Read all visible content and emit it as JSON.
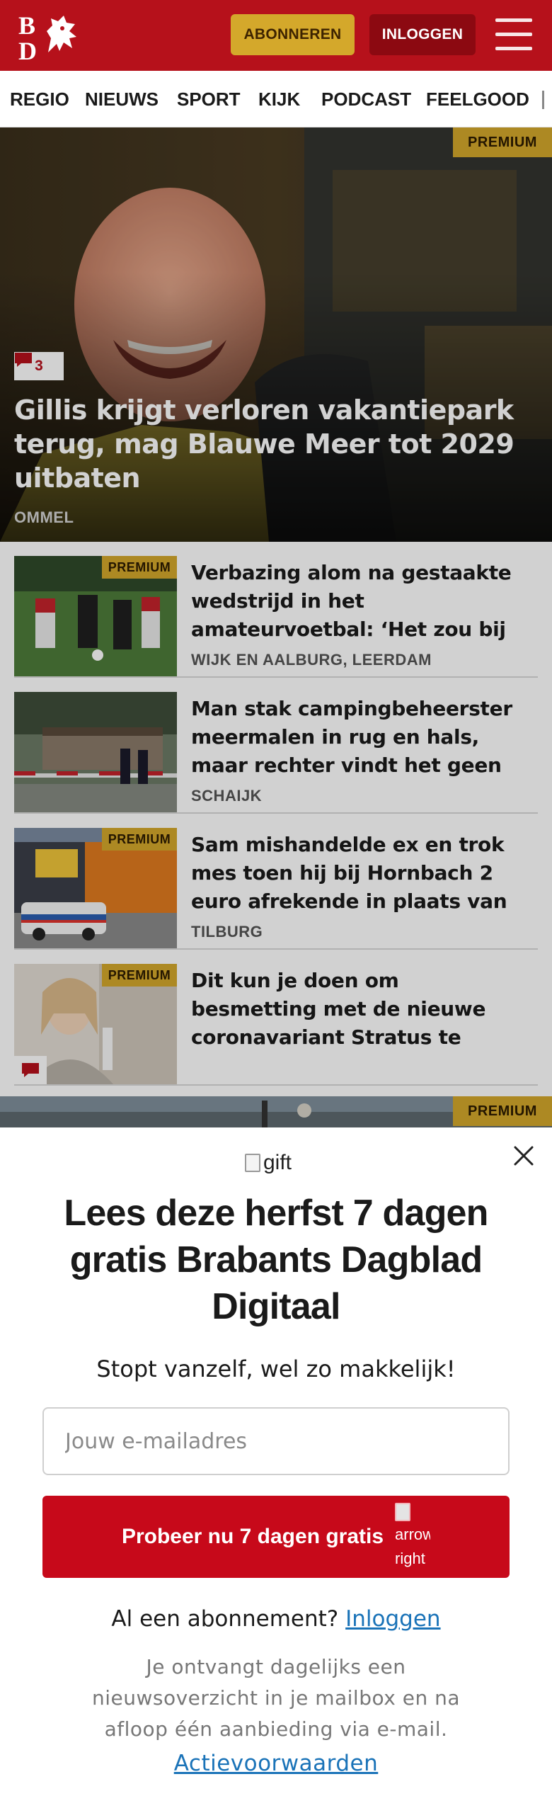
{
  "header": {
    "logo_text": "BD",
    "subscribe_label": "ABONNEREN",
    "login_label": "INLOGGEN",
    "menu_icon": "hamburger-menu-icon",
    "brand_color": "#b6111b",
    "accent_color": "#d4a82b"
  },
  "nav": {
    "items": [
      "REGIO",
      "NIEUWS",
      "SPORT",
      "KIJK",
      "PODCAST",
      "FEELGOOD"
    ]
  },
  "hero": {
    "badge": "PREMIUM",
    "comment_count": "3",
    "title": "Gillis krijgt verloren vakantiepark terug, mag Blauwe Meer tot 2029 uitbaten",
    "location": "OMMEL"
  },
  "articles": [
    {
      "badge": "PREMIUM",
      "title": "Verbazing alom na gestaakte wedstrijd in het amateurvoetbal: ‘Het zou bij de konijnen af zijn al...",
      "location": "WIJK EN AALBURG, LEERDAM"
    },
    {
      "badge": "",
      "title": "Man stak campingbeheerster meermalen in rug en hals, maar rechter vindt het geen poging t...",
      "location": "SCHAIJK"
    },
    {
      "badge": "PREMIUM",
      "title": "Sam mishandelde ex en trok mes toen hij bij Hornbach 2 euro afrekende in plaats van ruim...",
      "location": "TILBURG"
    },
    {
      "badge": "PREMIUM",
      "title": "Dit kun je doen om besmetting met de nieuwe coronavariant Stratus te voorkomen",
      "location": ""
    }
  ],
  "teaser": {
    "badge": "PREMIUM"
  },
  "modal": {
    "gift_alt": "gift",
    "heading": "Lees deze herfst 7 dagen gratis Brabants Dagblad Digitaal",
    "subheading": "Stopt vanzelf, wel zo makkelijk!",
    "email_placeholder": "Jouw e-mailadres",
    "cta_label": "Probeer nu 7 dagen gratis",
    "cta_arrow_alt": "arrow-right",
    "account_question": "Al een abonnement?",
    "account_link": "Inloggen",
    "disclaimer": "Je ontvangt dagelijks een nieuwsoverzicht in je mailbox en na afloop één aanbieding via e-mail.",
    "terms_link": "Actievoorwaarden"
  }
}
